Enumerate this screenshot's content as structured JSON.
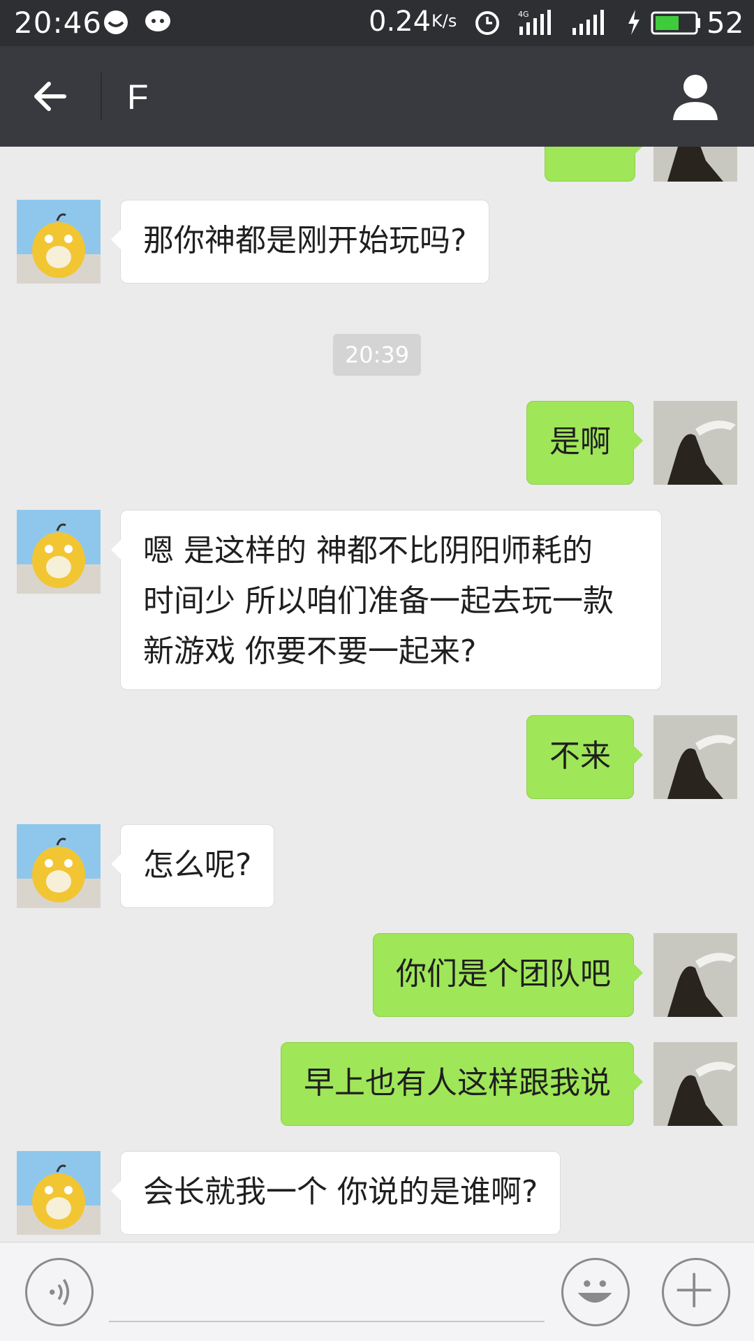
{
  "status_bar": {
    "time": "20:46",
    "net_speed": "0.24",
    "net_speed_unit": "K/s",
    "network_badge": "4G",
    "battery": "52"
  },
  "header": {
    "title": "F"
  },
  "messages": [
    {
      "side": "right",
      "text": "",
      "type": "partial"
    },
    {
      "side": "left",
      "text": "那你神都是刚开始玩吗?"
    },
    {
      "side": "time",
      "text": "20:39"
    },
    {
      "side": "right",
      "text": "是啊"
    },
    {
      "side": "left",
      "lines": [
        "嗯 是这样的 神都不比阴阳师耗的",
        "时间少 所以咱们准备一起去玩一款",
        "新游戏 你要不要一起来?"
      ]
    },
    {
      "side": "right",
      "text": "不来"
    },
    {
      "side": "left",
      "text": "怎么呢?"
    },
    {
      "side": "right",
      "text": "你们是个团队吧"
    },
    {
      "side": "right",
      "text": "早上也有人这样跟我说"
    },
    {
      "side": "left",
      "text": "会长就我一个 你说的是谁啊?"
    }
  ],
  "input": {
    "placeholder": ""
  },
  "colors": {
    "header_bg": "#393a3f",
    "status_bg": "#2e2f32",
    "chat_bg": "#ebebeb",
    "sent_bubble": "#9fe658",
    "received_bubble": "#ffffff"
  },
  "icons": {
    "back": "arrow-left-icon",
    "profile": "person-icon",
    "voice": "voice-icon",
    "emoji": "smile-icon",
    "plus": "plus-icon"
  }
}
